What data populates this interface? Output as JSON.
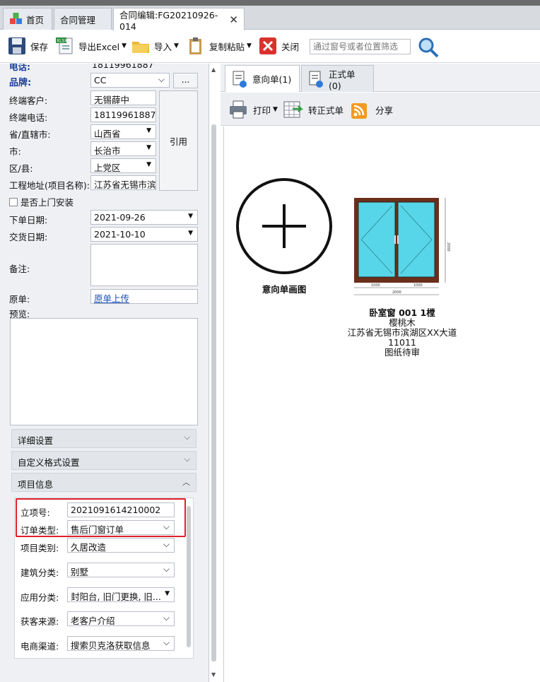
{
  "tabs": [
    {
      "label": "首页"
    },
    {
      "label": "合同管理"
    },
    {
      "label": "合同编辑:FG20210926-014"
    }
  ],
  "toolbar": {
    "save": "保存",
    "export_excel": "导出Excel",
    "import": "导入",
    "copy_paste": "复制粘贴",
    "close": "关闭",
    "search_placeholder": "通过窗号或者位置筛选"
  },
  "form": {
    "phone_label": "电话:",
    "phone_value": "18119961887",
    "brand_label": "品牌:",
    "brand_value": "CC",
    "brand_more": "...",
    "customer_label": "终端客户:",
    "customer_value": "无锡薛中",
    "customer_phone_label": "终端电话:",
    "customer_phone_value": "18119961887",
    "province_label": "省/直辖市:",
    "province_value": "山西省",
    "city_label": "市:",
    "city_value": "长治市",
    "district_label": "区/县:",
    "district_value": "上党区",
    "address_label": "工程地址(项目名称):",
    "address_value": "江苏省无锡市滨",
    "reference_button": "引用",
    "install_label": "是否上门安装",
    "order_date_label": "下单日期:",
    "order_date_value": "2021-09-26",
    "delivery_date_label": "交货日期:",
    "delivery_date_value": "2021-10-10",
    "notes_label": "备注:",
    "original_label": "原单:",
    "original_link": "原单上传",
    "preview_label": "预览:"
  },
  "sections": {
    "detail": "详细设置",
    "custom_format": "自定义格式设置",
    "project_info": "项目信息"
  },
  "project": {
    "id_label": "立项号:",
    "id_value": "2021091614210002",
    "order_type_label": "订单类型:",
    "order_type_value": "售后门窗订单",
    "category_label": "项目类别:",
    "category_value": "久居改造",
    "building_label": "建筑分类:",
    "building_value": "别墅",
    "application_label": "应用分类:",
    "application_value": "封阳台, 旧门更换, 旧...",
    "source_label": "获客来源:",
    "source_value": "老客户介绍",
    "channel_label": "电商渠道:",
    "channel_value": "搜索贝克洛获取信息"
  },
  "right_tabs": [
    {
      "label": "意向单(1)"
    },
    {
      "label": "正式单(0)"
    }
  ],
  "right_toolbar": {
    "print": "打印",
    "to_formal": "转正式单",
    "share": "分享"
  },
  "canvas": {
    "add_caption": "意向单画图",
    "window_title": "卧室窗 001 1樘",
    "window_material": "樱桃木",
    "window_address": "江苏省无锡市滨湖区XX大道",
    "window_code": "11011",
    "window_status": "图纸待审",
    "dim_1000a": "1000",
    "dim_1000b": "1000",
    "dim_2000w": "2000",
    "dim_2000h": "2000"
  },
  "colors": {
    "highlight_border": "#e0202c",
    "window_frame": "#6b2e1a",
    "window_glass": "#56d6e8"
  }
}
